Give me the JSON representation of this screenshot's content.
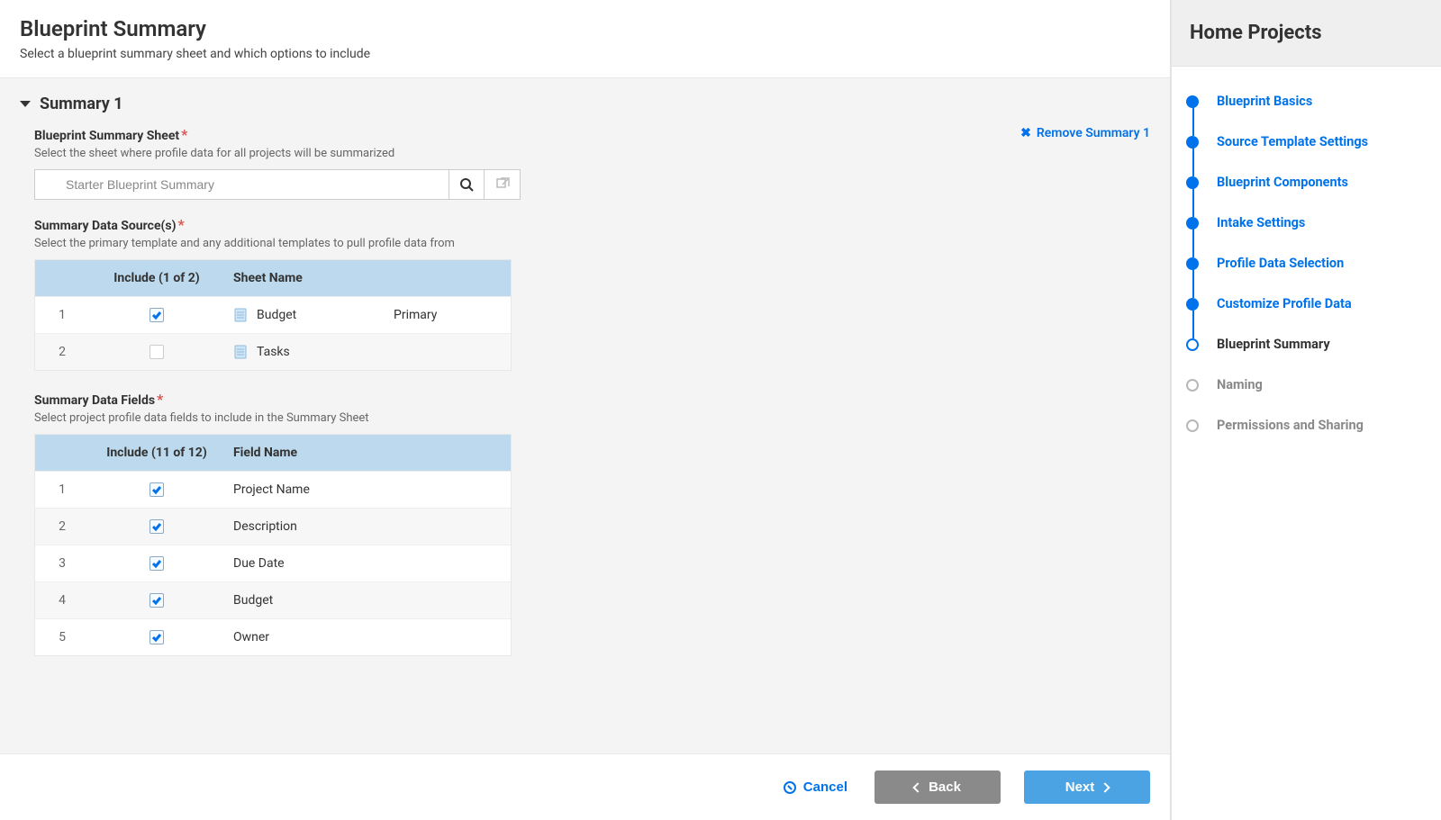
{
  "header": {
    "title": "Blueprint Summary",
    "subtitle": "Select a blueprint summary sheet and which options to include"
  },
  "summary": {
    "title": "Summary 1",
    "remove_label": "Remove Summary 1",
    "sheet_section": {
      "label": "Blueprint Summary Sheet",
      "help": "Select the sheet where profile data for all projects will be summarized",
      "value": "Starter Blueprint Summary"
    },
    "sources_section": {
      "label": "Summary Data Source(s)",
      "help": "Select the primary template and any additional templates to pull profile data from",
      "include_header": "Include (1 of 2)",
      "sheet_header": "Sheet Name",
      "role_header": "",
      "rows": [
        {
          "num": "1",
          "checked": true,
          "name": "Budget",
          "role": "Primary"
        },
        {
          "num": "2",
          "checked": false,
          "name": "Tasks",
          "role": ""
        }
      ]
    },
    "fields_section": {
      "label": "Summary Data Fields",
      "help": "Select project profile data fields to include in the Summary Sheet",
      "include_header": "Include (11 of 12)",
      "field_header": "Field Name",
      "rows": [
        {
          "num": "1",
          "checked": true,
          "name": "Project Name"
        },
        {
          "num": "2",
          "checked": true,
          "name": "Description"
        },
        {
          "num": "3",
          "checked": true,
          "name": "Due Date"
        },
        {
          "num": "4",
          "checked": true,
          "name": "Budget"
        },
        {
          "num": "5",
          "checked": true,
          "name": "Owner"
        }
      ]
    }
  },
  "footer": {
    "cancel": "Cancel",
    "back": "Back",
    "next": "Next"
  },
  "sidebar": {
    "title": "Home Projects",
    "steps": [
      {
        "label": "Blueprint Basics",
        "state": "done"
      },
      {
        "label": "Source Template Settings",
        "state": "done"
      },
      {
        "label": "Blueprint Components",
        "state": "done"
      },
      {
        "label": "Intake Settings",
        "state": "done"
      },
      {
        "label": "Profile Data Selection",
        "state": "done"
      },
      {
        "label": "Customize Profile Data",
        "state": "done"
      },
      {
        "label": "Blueprint Summary",
        "state": "current"
      },
      {
        "label": "Naming",
        "state": "future"
      },
      {
        "label": "Permissions and Sharing",
        "state": "future"
      }
    ]
  }
}
